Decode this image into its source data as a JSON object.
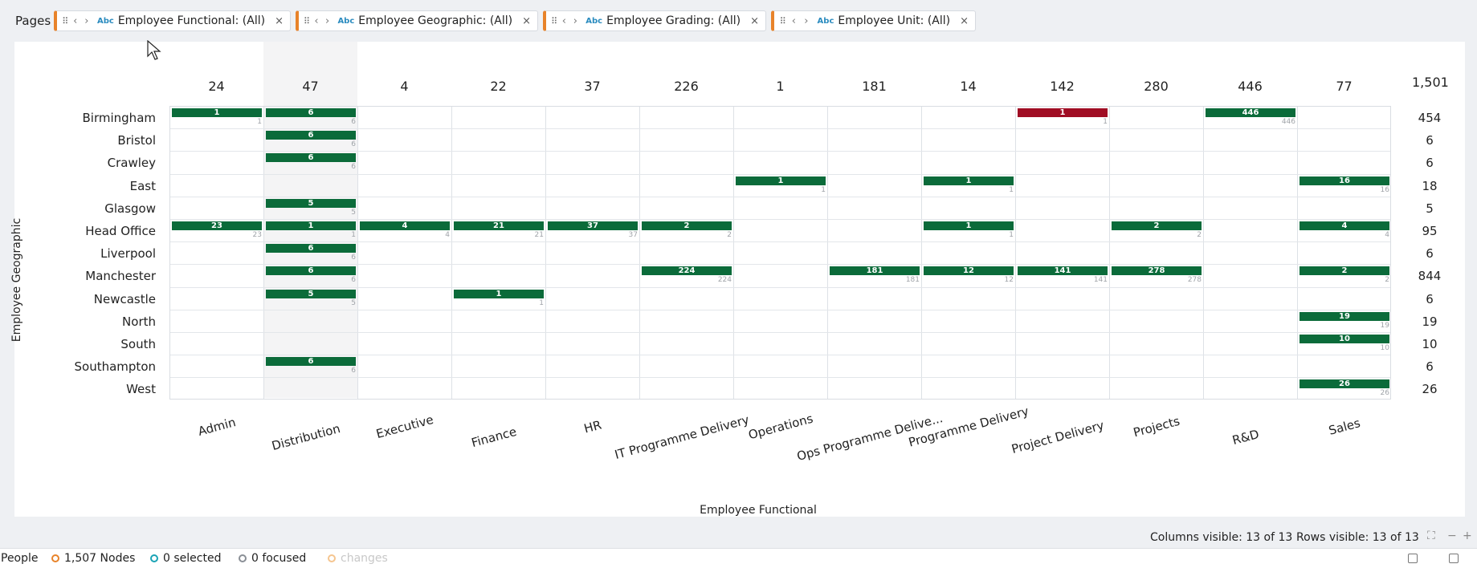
{
  "pages": {
    "label": "Pages",
    "filters": [
      {
        "label": "Employee Functional: (All)",
        "type": "Abc"
      },
      {
        "label": "Employee Geographic: (All)",
        "type": "Abc"
      },
      {
        "label": "Employee Grading: (All)",
        "type": "Abc"
      },
      {
        "label": "Employee Unit: (All)",
        "type": "Abc"
      }
    ]
  },
  "matrix": {
    "x_title": "Employee Functional",
    "y_title": "Employee Geographic",
    "grand_total": "1,501",
    "columns": [
      "Admin",
      "Distribution",
      "Executive",
      "Finance",
      "HR",
      "IT Programme Delivery",
      "Operations",
      "Ops Programme Delive...",
      "Programme Delivery",
      "Project Delivery",
      "Projects",
      "R&D",
      "Sales"
    ],
    "column_totals": [
      "24",
      "47",
      "4",
      "22",
      "37",
      "226",
      "1",
      "181",
      "14",
      "142",
      "280",
      "446",
      "77"
    ],
    "rows": [
      "Birmingham",
      "Bristol",
      "Crawley",
      "East",
      "Glasgow",
      "Head Office",
      "Liverpool",
      "Manchester",
      "Newcastle",
      "North",
      "South",
      "Southampton",
      "West"
    ],
    "row_totals": [
      "454",
      "6",
      "6",
      "18",
      "5",
      "95",
      "6",
      "844",
      "6",
      "19",
      "10",
      "6",
      "26"
    ],
    "cells": [
      {
        "row": 0,
        "col": 0,
        "value": 1
      },
      {
        "row": 0,
        "col": 1,
        "value": 6
      },
      {
        "row": 0,
        "col": 9,
        "value": 1,
        "highlight": "#a00d24"
      },
      {
        "row": 0,
        "col": 11,
        "value": 446
      },
      {
        "row": 1,
        "col": 1,
        "value": 6
      },
      {
        "row": 2,
        "col": 1,
        "value": 6
      },
      {
        "row": 3,
        "col": 6,
        "value": 1
      },
      {
        "row": 3,
        "col": 8,
        "value": 1
      },
      {
        "row": 3,
        "col": 12,
        "value": 16
      },
      {
        "row": 4,
        "col": 1,
        "value": 5
      },
      {
        "row": 5,
        "col": 0,
        "value": 23
      },
      {
        "row": 5,
        "col": 1,
        "value": 1
      },
      {
        "row": 5,
        "col": 2,
        "value": 4
      },
      {
        "row": 5,
        "col": 3,
        "value": 21
      },
      {
        "row": 5,
        "col": 4,
        "value": 37
      },
      {
        "row": 5,
        "col": 5,
        "value": 2
      },
      {
        "row": 5,
        "col": 8,
        "value": 1
      },
      {
        "row": 5,
        "col": 10,
        "value": 2
      },
      {
        "row": 5,
        "col": 12,
        "value": 4
      },
      {
        "row": 6,
        "col": 1,
        "value": 6
      },
      {
        "row": 7,
        "col": 1,
        "value": 6
      },
      {
        "row": 7,
        "col": 5,
        "value": 224
      },
      {
        "row": 7,
        "col": 7,
        "value": 181
      },
      {
        "row": 7,
        "col": 8,
        "value": 12
      },
      {
        "row": 7,
        "col": 9,
        "value": 141
      },
      {
        "row": 7,
        "col": 10,
        "value": 278
      },
      {
        "row": 7,
        "col": 12,
        "value": 2
      },
      {
        "row": 8,
        "col": 1,
        "value": 5
      },
      {
        "row": 8,
        "col": 3,
        "value": 1
      },
      {
        "row": 9,
        "col": 12,
        "value": 19
      },
      {
        "row": 10,
        "col": 12,
        "value": 10
      },
      {
        "row": 11,
        "col": 1,
        "value": 6
      },
      {
        "row": 12,
        "col": 12,
        "value": 26
      }
    ],
    "bar_color": "#0b6b3a",
    "columns_visible": "Columns visible: 13 of 13",
    "rows_visible": "Rows visible: 13 of 13"
  },
  "footer": {
    "title": "People",
    "nodes": "1,507 Nodes",
    "selected": "0 selected",
    "focused": "0 focused",
    "changes": "changes"
  },
  "colors": {
    "accent": "#e8832a",
    "selected_dot": "#1aa3b5",
    "focused_dot": "#8a8f96",
    "changes_dot": "#f5c58f"
  }
}
